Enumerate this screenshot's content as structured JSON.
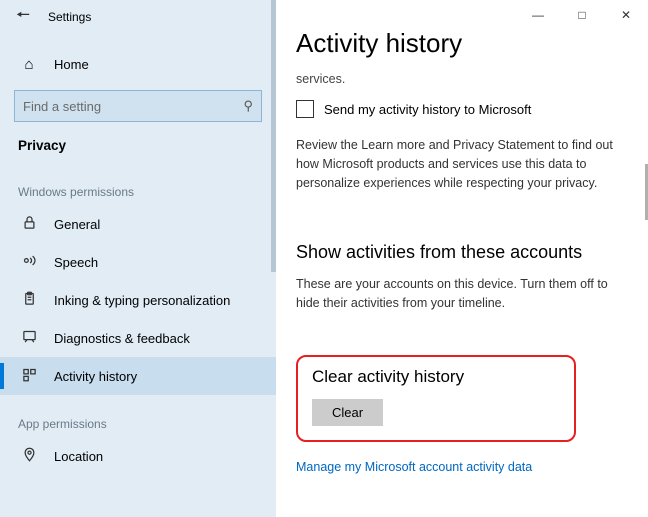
{
  "app_title": "Settings",
  "home_label": "Home",
  "search_placeholder": "Find a setting",
  "nav_title": "Privacy",
  "section_windows": "Windows permissions",
  "section_app": "App permissions",
  "nav": {
    "general": "General",
    "speech": "Speech",
    "inking": "Inking & typing personalization",
    "diagnostics": "Diagnostics & feedback",
    "activity": "Activity history",
    "location": "Location"
  },
  "page": {
    "title": "Activity history",
    "truncated": "services.",
    "checkbox_label": "Send my activity history to Microsoft",
    "review_text": "Review the Learn more and Privacy Statement to find out how Microsoft products and services use this data to personalize experiences while respecting your privacy.",
    "accounts_heading": "Show activities from these accounts",
    "accounts_text": "These are your accounts on this device. Turn them off to hide their activities from your timeline.",
    "clear_heading": "Clear activity history",
    "clear_button": "Clear",
    "manage_link": "Manage my Microsoft account activity data"
  }
}
